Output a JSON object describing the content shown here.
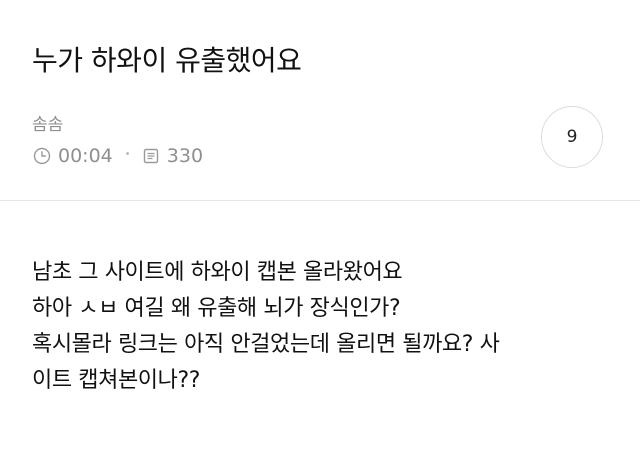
{
  "post": {
    "title": "누가 하와이 유출했어요",
    "author": "솜솜",
    "time": "00:04",
    "views": "330",
    "comments": "9",
    "body_lines": [
      "남초 그 사이트에 하와이 캡본 올라왔어요",
      "하아 ㅅㅂ 여길 왜 유출해 뇌가 장식인가?",
      "혹시몰라 링크는 아직 안걸었는데 올리면 될까요? 사",
      "이트 캡쳐본이나??"
    ]
  },
  "icons": {
    "time": "clock-icon",
    "views": "document-icon"
  },
  "colors": {
    "text": "#111111",
    "meta": "#8f8f8f",
    "divider": "#e6e6e6",
    "circle_border": "#dcdcdc"
  }
}
